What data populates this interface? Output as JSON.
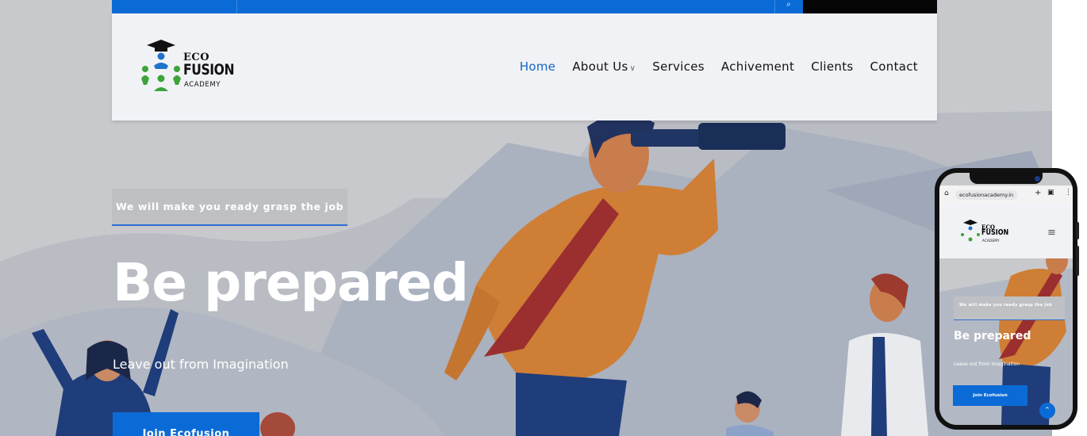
{
  "nav": {
    "logo": {
      "eco": "ECO",
      "fusion": "FUSION",
      "academy": "ACADEMY"
    },
    "items": [
      {
        "label": "Home",
        "active": true
      },
      {
        "label": "About Us",
        "dropdown": true
      },
      {
        "label": "Services"
      },
      {
        "label": "Achivement"
      },
      {
        "label": "Clients"
      },
      {
        "label": "Contact"
      }
    ]
  },
  "hero": {
    "tagline": "We will make you ready grasp the job",
    "headline": "Be prepared",
    "subline": "Leave out from Imagination",
    "cta": "Join Ecofusion"
  },
  "mobile": {
    "url": "ecofusionacademy.in",
    "tagline": "We will make you ready grasp the job",
    "headline": "Be prepared",
    "subline": "Leave out from Imagination",
    "cta": "Join Ecofusion"
  },
  "colors": {
    "accent": "#0a6bd6",
    "hero_bg": "#c8c9cc",
    "nav_bg": "#f1f2f6",
    "active_link": "#1266c4"
  },
  "icons": [
    "search-icon",
    "chevron-down-icon",
    "home-icon",
    "menu-icon",
    "arrow-up-icon"
  ]
}
